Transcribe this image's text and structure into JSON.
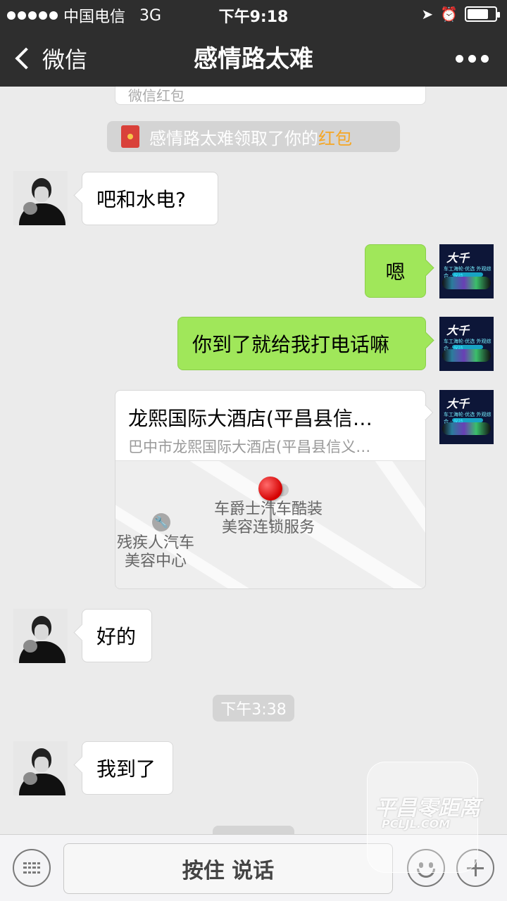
{
  "status_bar": {
    "carrier": "中国电信",
    "network": "3G",
    "time": "下午9:18",
    "battery_level": 0.75
  },
  "nav": {
    "back_label": "微信",
    "title": "感情路太难"
  },
  "chat": {
    "previous_card_label": "微信红包",
    "hongbao_notice": {
      "text": "感情路太难领取了你的",
      "link": "红包"
    },
    "messages": [
      {
        "side": "in",
        "text": "吧和水电?"
      },
      {
        "side": "out",
        "text": "嗯"
      },
      {
        "side": "out",
        "text": "你到了就给我打电话嘛"
      },
      {
        "side": "out",
        "type": "location",
        "title": "龙熙国际大酒店(平昌县信…",
        "address": "巴中市龙熙国际大酒店(平昌县信义…",
        "poi_1": "车爵士汽车酷装\n美容连锁服务",
        "poi_2": "残疾人汽车\n美容中心"
      },
      {
        "side": "in",
        "text": "好的"
      },
      {
        "side": "in",
        "text": "我到了"
      }
    ],
    "time_divider": "下午3:38"
  },
  "avatar_brand": {
    "title": "大千",
    "subtitle": "车工海轮·优选 外观综合 · 保持"
  },
  "input_bar": {
    "talk_label": "按住 说话"
  },
  "watermark": {
    "text": "平昌零距离",
    "sub": "PCLJL.COM"
  },
  "colors": {
    "nav_bg": "#2e2e2e",
    "chat_bg": "#ebebeb",
    "outgoing_bubble": "#a0e75a",
    "link": "#f5a623"
  }
}
